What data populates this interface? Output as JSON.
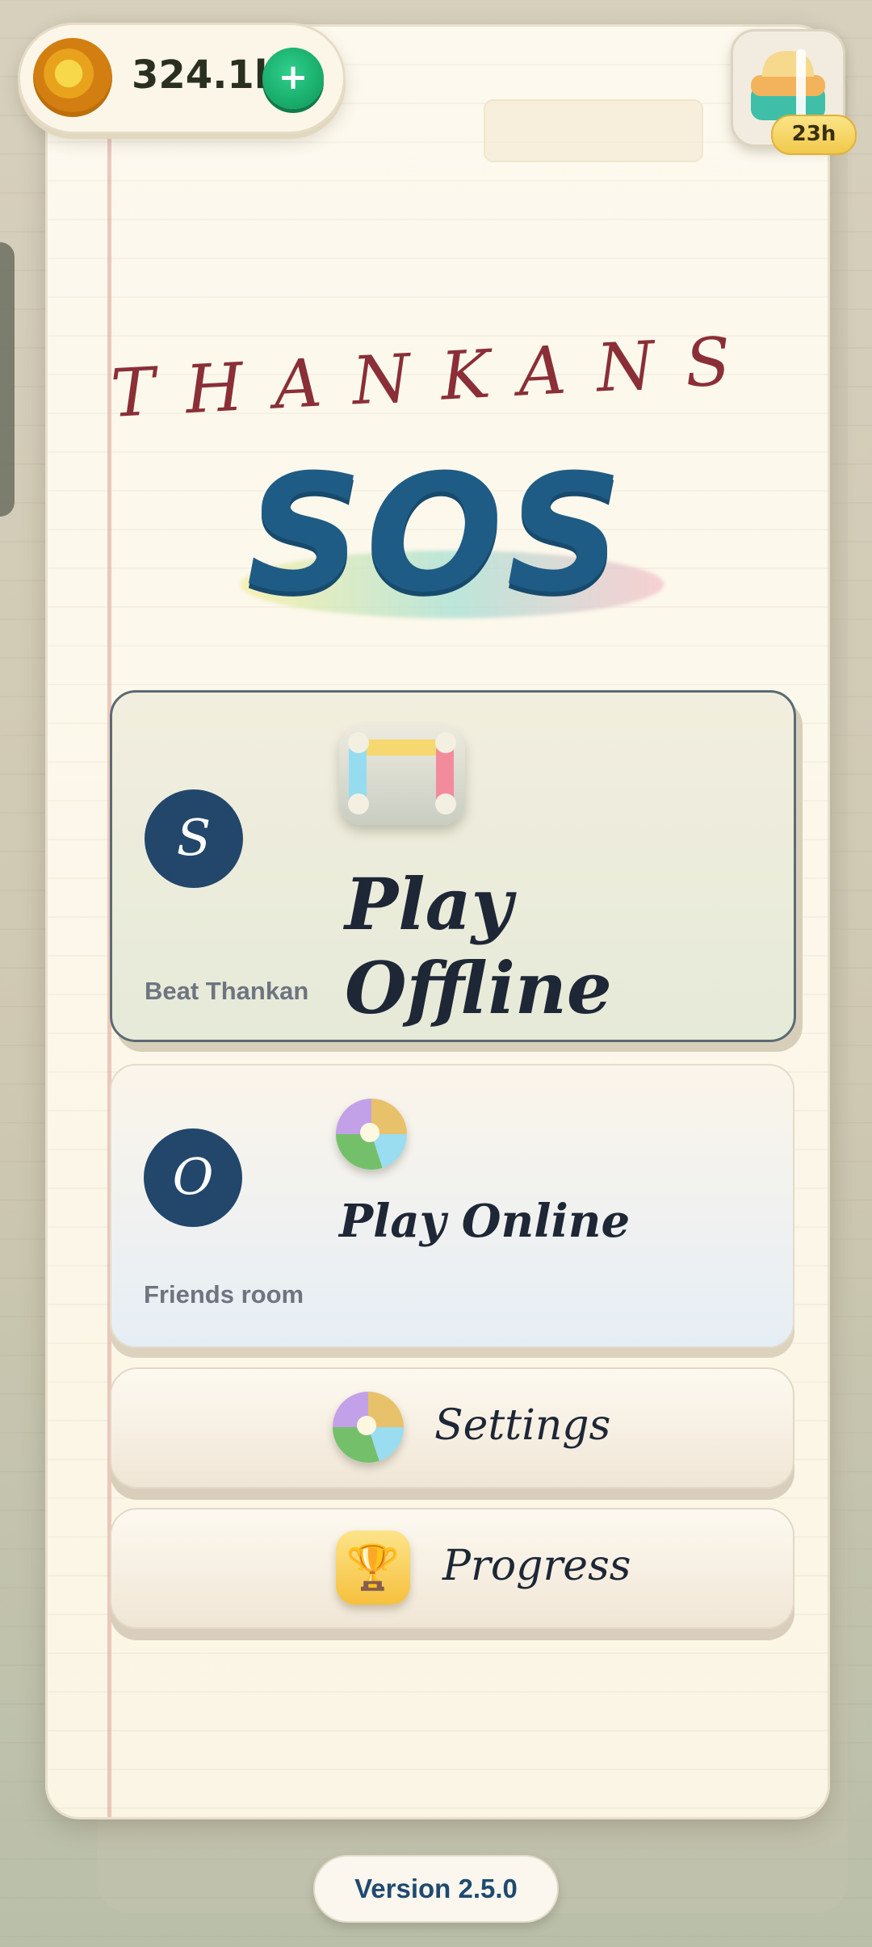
{
  "header": {
    "coins": "324.1k",
    "add_coins_label": "+",
    "gift_timer": "23h"
  },
  "title": {
    "brand": "THANKANS",
    "game": "SOS"
  },
  "menu": {
    "offline": {
      "letter": "S",
      "title": "Play Offline",
      "subtitle": "Beat Thankan"
    },
    "online": {
      "letter": "O",
      "title": "Play Online",
      "subtitle": "Friends room"
    },
    "settings": {
      "label": "Settings",
      "icon": "palette-icon"
    },
    "progress": {
      "label": "Progress",
      "icon": "trophy-icon",
      "glyph": "🏆"
    }
  },
  "footer": {
    "version": "Version 2.5.0"
  },
  "colors": {
    "brand": "#8a2f37",
    "title": "#1f5c85",
    "badge": "#22476b",
    "add_button": "#17a866"
  }
}
